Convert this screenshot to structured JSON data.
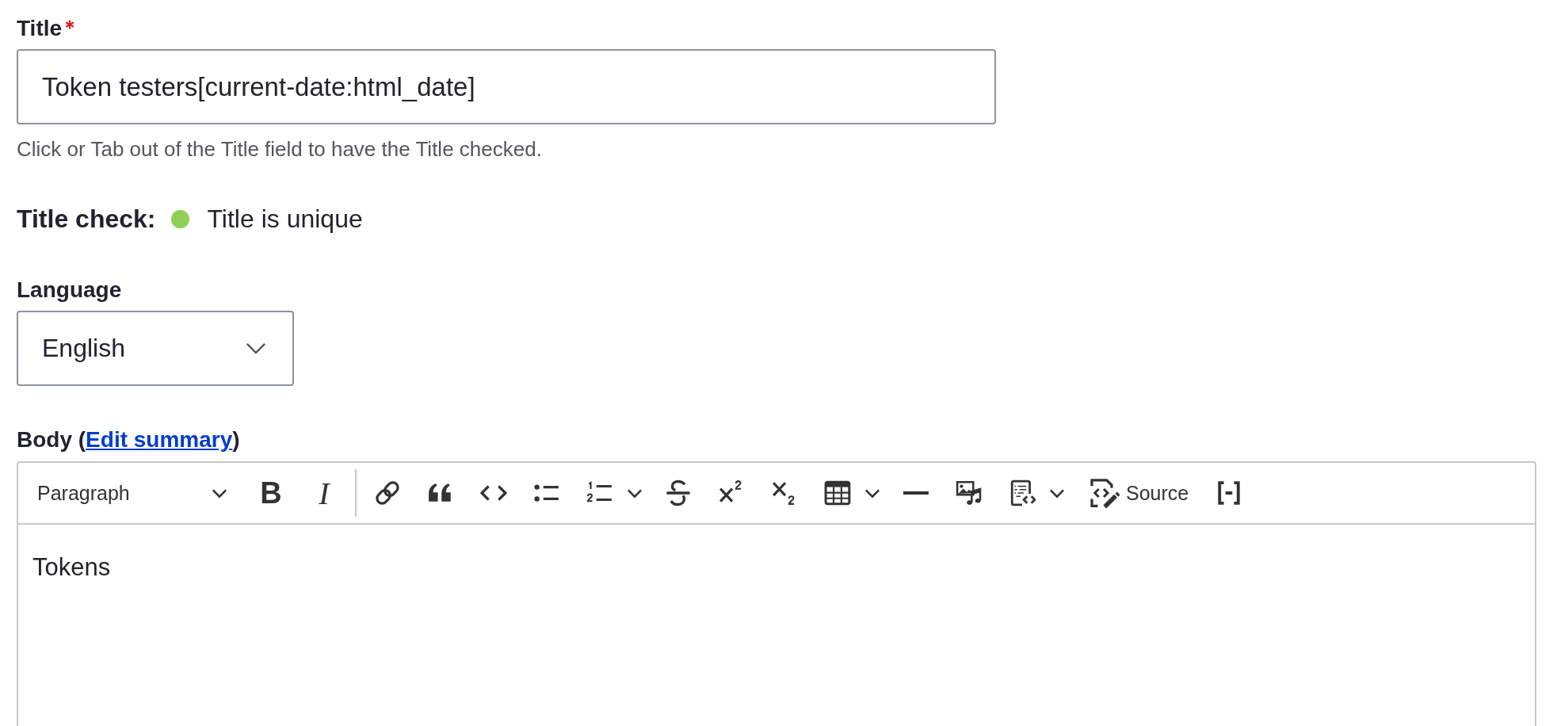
{
  "title_field": {
    "label": "Title",
    "required": true,
    "value": "Token testers[current-date:html_date]",
    "description": "Click or Tab out of the Title field to have the Title checked."
  },
  "title_check": {
    "label": "Title check:",
    "status": "Title is unique",
    "color": "#8fd056"
  },
  "language": {
    "label": "Language",
    "value": "English"
  },
  "body": {
    "label_before": "Body (",
    "link": "Edit summary",
    "label_after": ")",
    "toolbar": {
      "block_format": "Paragraph",
      "bold_glyph": "B",
      "italic_glyph": "I",
      "source_label": "Source"
    },
    "content": "Tokens"
  }
}
